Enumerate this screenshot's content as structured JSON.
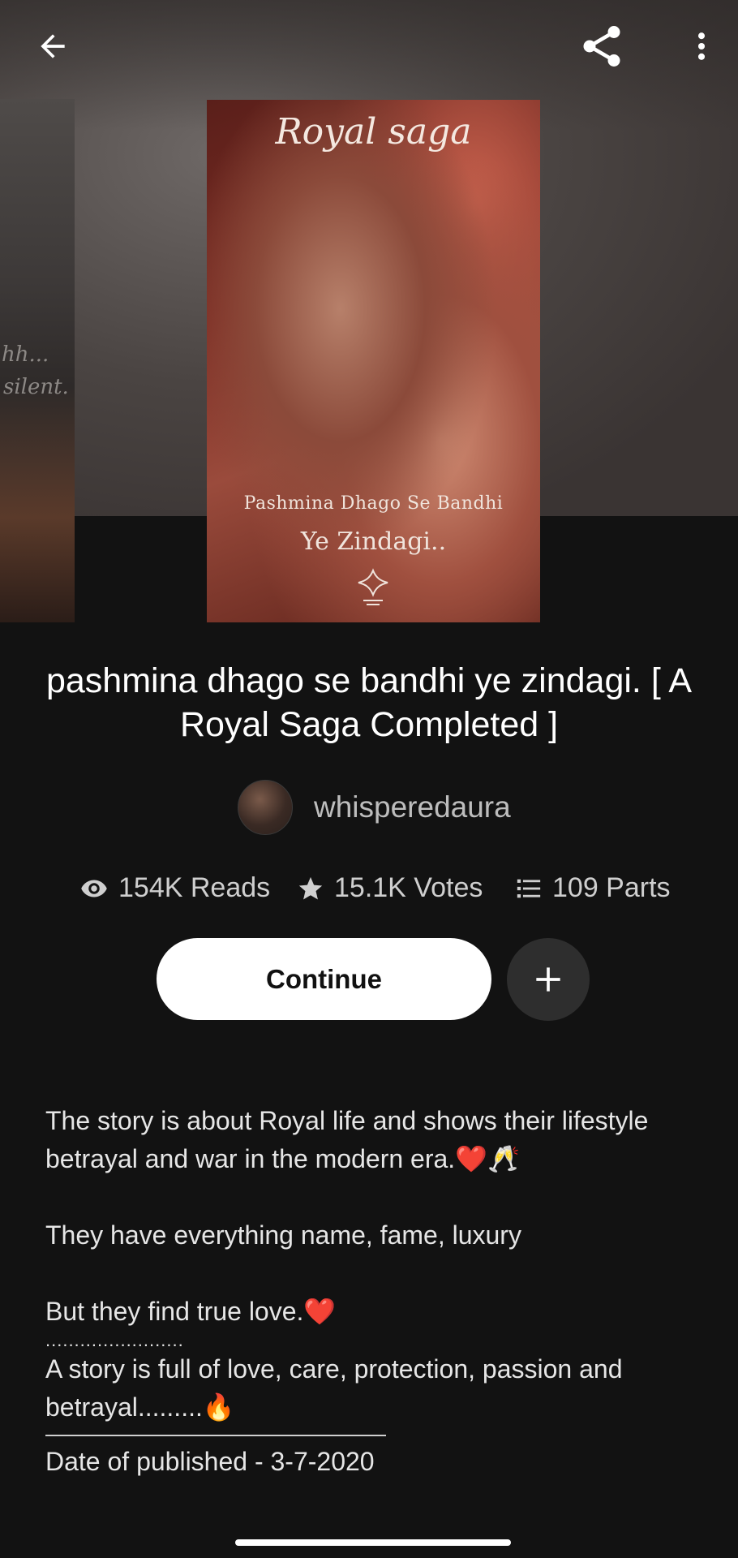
{
  "header": {
    "back_icon": "arrow-left-icon",
    "share_icon": "share-icon",
    "more_icon": "more-vertical-icon"
  },
  "cover": {
    "title": "Royal saga",
    "subtitle": "Pashmina Dhago Se Bandhi",
    "subtitle2": "Ye Zindagi..",
    "side_text_1": "hh...",
    "side_text_2": "silent."
  },
  "story": {
    "title": "pashmina dhago se bandhi ye zindagi. [ A Royal Saga Completed ]",
    "author": "whisperedaura"
  },
  "stats": {
    "reads": "154K Reads",
    "votes": "15.1K Votes",
    "parts": "109 Parts"
  },
  "actions": {
    "continue_label": "Continue",
    "add_icon": "plus-icon"
  },
  "description": {
    "line1": "The story is about Royal life and shows their lifestyle betrayal and war in the modern era.",
    "line1_emoji": "❤️🥂",
    "line2": "They have everything name, fame, luxury",
    "line3": "But they find true love.",
    "line3_emoji": "❤️",
    "dots": "........................",
    "line4": "A story is full of love, care, protection, passion and betrayal.........",
    "line4_emoji": "🔥",
    "date": "Date of published - 3-7-2020"
  },
  "colors": {
    "background": "#121212",
    "button_bg": "#ffffff",
    "add_button_bg": "#2e2e2e"
  }
}
